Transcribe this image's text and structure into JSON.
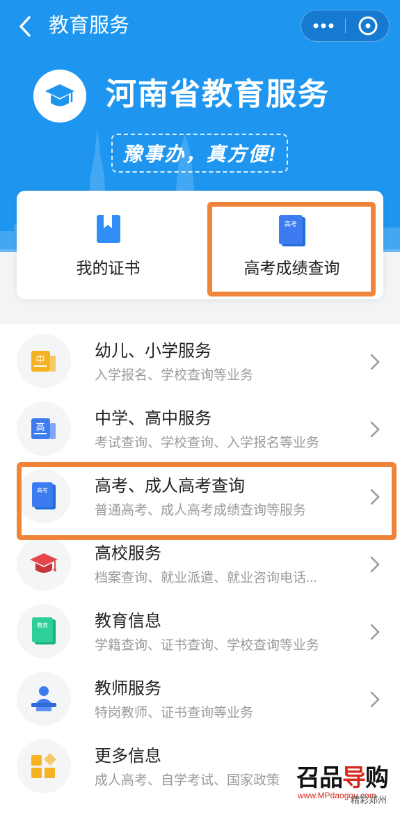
{
  "nav": {
    "title": "教育服务"
  },
  "brand": {
    "title": "河南省教育服务",
    "slogan": "豫事办，真方便!"
  },
  "cards": [
    {
      "label": "我的证书",
      "icon": "bookmark-book-icon"
    },
    {
      "label": "高考成绩查询",
      "icon": "exam-book-icon",
      "icon_text": "高考"
    }
  ],
  "services": [
    {
      "title": "幼儿、小学服务",
      "subtitle": "入学报名、学校查询等业务",
      "icon": "primary-school-icon",
      "icon_text": "中",
      "color": "#f5b324"
    },
    {
      "title": "中学、高中服务",
      "subtitle": "考试查询、学校查询、入学报名等业务",
      "icon": "high-school-icon",
      "icon_text": "高",
      "color": "#3d7bf0"
    },
    {
      "title": "高考、成人高考查询",
      "subtitle": "普通高考、成人高考成绩查询等服务",
      "icon": "exam-book-icon",
      "icon_text": "高考",
      "color": "#3d7bf0"
    },
    {
      "title": "高校服务",
      "subtitle": "档案查询、就业派遣、就业咨询电话...",
      "icon": "graduation-cap-icon",
      "color": "#e8454a"
    },
    {
      "title": "教育信息",
      "subtitle": "学籍查询、证书查询、学校查询等业务",
      "icon": "education-book-icon",
      "icon_text": "教育",
      "color": "#2fcf9a"
    },
    {
      "title": "教师服务",
      "subtitle": "特岗教师、证书查询等业务",
      "icon": "teacher-icon",
      "color": "#3d7bf0"
    },
    {
      "title": "更多信息",
      "subtitle": "成人高考、自学考试、国家政策",
      "icon": "grid-more-icon",
      "color": "#f5b324"
    }
  ],
  "watermark": {
    "logo_a": "召品",
    "logo_b": "导",
    "logo_c": "购",
    "url": "www.MPdaogou.com",
    "caption": "精彩郑州"
  },
  "colors": {
    "header": "#1e96f0",
    "highlight": "#f0853a",
    "icon_blue": "#2f8ef5"
  }
}
